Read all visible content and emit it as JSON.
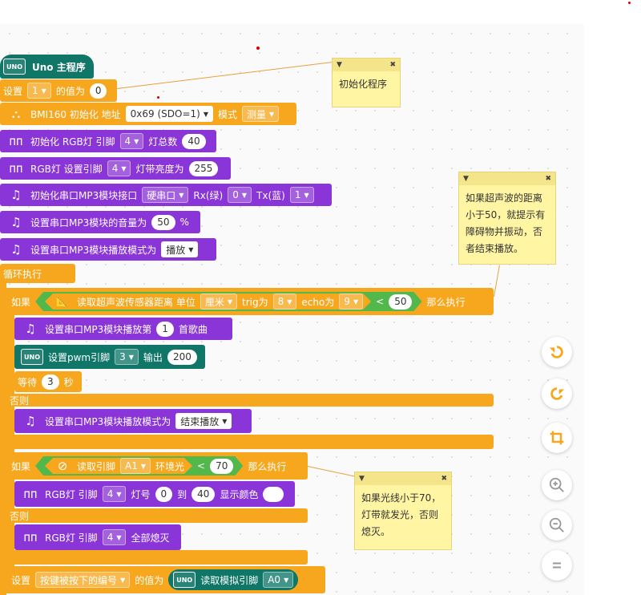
{
  "main": {
    "label": "Uno 主程序"
  },
  "setup": {
    "set1": {
      "prefix": "设置",
      "var": "1",
      "mid": "的值为",
      "value": "0"
    },
    "bmi": {
      "label": "BMI160 初始化 地址",
      "addr": "0x69 (SDO=1)",
      "mode_label": "模式",
      "mode": "测量"
    },
    "rgb_init": {
      "label": "初始化 RGB灯 引脚",
      "pin": "4",
      "count_label": "灯总数",
      "count": "40"
    },
    "rgb_bright": {
      "label": "RGB灯 设置引脚",
      "pin": "4",
      "bright_label": "灯带亮度为",
      "value": "255"
    },
    "mp3_init": {
      "label": "初始化串口MP3模块接口",
      "port": "硬串口",
      "rx_label": "Rx(绿)",
      "rx": "0",
      "tx_label": "Tx(蓝)",
      "tx": "1"
    },
    "mp3_vol": {
      "label": "设置串口MP3模块的音量为",
      "value": "50",
      "unit": "%"
    },
    "mp3_mode": {
      "label": "设置串口MP3模块播放模式为",
      "mode": "播放"
    }
  },
  "loop": {
    "label": "循环执行",
    "if1": {
      "if_label": "如果",
      "cond": {
        "label": "读取超声波传感器距离 单位",
        "unit": "厘米",
        "trig_label": "trig为",
        "trig": "8",
        "echo_label": "echo为",
        "echo": "9",
        "op": "<",
        "value": "50"
      },
      "then_label": "那么执行",
      "play": {
        "label": "设置串口MP3模块播放第",
        "num": "1",
        "suffix": "首歌曲"
      },
      "pwm": {
        "label": "设置pwm引脚",
        "pin": "3",
        "out_label": "输出",
        "value": "200"
      },
      "wait": {
        "label": "等待",
        "value": "3",
        "unit": "秒"
      },
      "else_label": "否则",
      "stop": {
        "label": "设置串口MP3模块播放模式为",
        "mode": "结束播放"
      }
    },
    "if2": {
      "if_label": "如果",
      "cond": {
        "label": "读取引脚",
        "pin": "A1",
        "sensor": "环境光",
        "op": "<",
        "value": "70"
      },
      "then_label": "那么执行",
      "rgb_show": {
        "label": "RGB灯 引脚",
        "pin": "4",
        "from_label": "灯号",
        "from": "0",
        "to_label": "到",
        "to": "40",
        "color_label": "显示颜色"
      },
      "else_label": "否则",
      "rgb_off": {
        "label": "RGB灯 引脚",
        "pin": "4",
        "suffix": "全部熄灭"
      }
    },
    "set_key": {
      "prefix": "设置",
      "var": "按键被按下的编号",
      "mid": "的值为",
      "read_label": "读取模拟引脚",
      "pin": "A0"
    }
  },
  "notes": [
    {
      "text": "初始化程序"
    },
    {
      "text": "如果超声波的距离小于50，就提示有障碍物并振动，否者结束播放。"
    },
    {
      "text": "如果光线小于70，灯带就发光，否则熄灭。"
    }
  ],
  "controls": [
    {
      "icon": "undo-icon"
    },
    {
      "icon": "redo-icon"
    },
    {
      "icon": "crop-icon"
    },
    {
      "icon": "zoom-in-icon"
    },
    {
      "icon": "zoom-out-icon"
    },
    {
      "icon": "reset-zoom-icon"
    }
  ],
  "colors": {
    "control_orange": "#f7a71d",
    "module_purple": "#8a35d8",
    "board_teal": "#0f7668",
    "sensor_green": "#52b84c",
    "note_yellow": "#fff5a3"
  }
}
